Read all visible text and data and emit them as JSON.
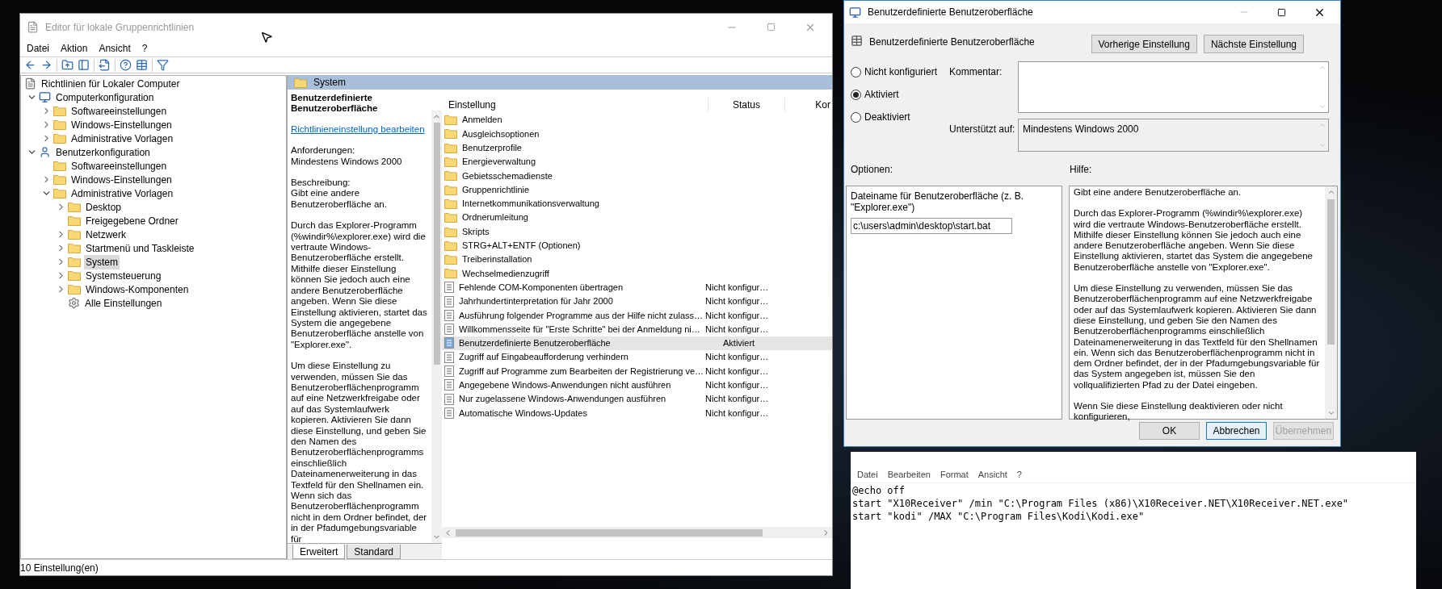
{
  "editor": {
    "title": "Editor für lokale Gruppenrichtlinien",
    "menu": [
      "Datei",
      "Aktion",
      "Ansicht",
      "?"
    ],
    "tree": {
      "label": "Richtlinien für Lokaler Computer",
      "kind": "policy",
      "selected": false,
      "children": [
        {
          "label": "Computerkonfiguration",
          "kind": "computer",
          "expanded": true,
          "selected": false,
          "children": [
            {
              "label": "Softwareeinstellungen",
              "expanded": false,
              "selected": false
            },
            {
              "label": "Windows-Einstellungen",
              "expanded": false,
              "selected": false
            },
            {
              "label": "Administrative Vorlagen",
              "expanded": false,
              "selected": false
            }
          ]
        },
        {
          "label": "Benutzerkonfiguration",
          "kind": "user",
          "expanded": true,
          "selected": false,
          "children": [
            {
              "label": "Softwareeinstellungen",
              "selected": false
            },
            {
              "label": "Windows-Einstellungen",
              "expanded": false,
              "selected": false
            },
            {
              "label": "Administrative Vorlagen",
              "expanded": true,
              "selected": false,
              "children": [
                {
                  "label": "Desktop",
                  "expanded": false,
                  "selected": false
                },
                {
                  "label": "Freigegebene Ordner",
                  "selected": false
                },
                {
                  "label": "Netzwerk",
                  "expanded": false,
                  "selected": false
                },
                {
                  "label": "Startmenü und Taskleiste",
                  "expanded": false,
                  "selected": false
                },
                {
                  "label": "System",
                  "expanded": false,
                  "selected": true
                },
                {
                  "label": "Systemsteuerung",
                  "expanded": false,
                  "selected": false
                },
                {
                  "label": "Windows-Komponenten",
                  "expanded": false,
                  "selected": false
                },
                {
                  "label": "Alle Einstellungen",
                  "kind": "all",
                  "selected": false
                }
              ]
            }
          ]
        }
      ]
    },
    "header": "System",
    "details": {
      "title": "Benutzerdefinierte Benutzeroberfläche",
      "link": "Richtlinieneinstellung bearbeiten",
      "requirements_label": "Anforderungen:",
      "requirements": "Mindestens Windows 2000",
      "description_label": "Beschreibung:",
      "paragraphs": [
        "Gibt eine andere Benutzeroberfläche an.",
        "Durch das Explorer-Programm (%windir%\\explorer.exe) wird die vertraute Windows-Benutzeroberfläche erstellt. Mithilfe dieser Einstellung können Sie jedoch auch eine andere Benutzeroberfläche angeben. Wenn Sie diese Einstellung aktivieren, startet das System die angegebene Benutzeroberfläche anstelle von \"Explorer.exe\".",
        "Um diese Einstellung zu verwenden, müssen Sie das Benutzeroberflächenprogramm auf eine Netzwerkfreigabe oder auf das Systemlaufwerk kopieren. Aktivieren Sie dann diese Einstellung, und geben Sie den Namen des Benutzeroberflächenprogramms einschließlich Dateinamenerweiterung in das Textfeld für den Shellnamen ein. Wenn sich das Benutzeroberflächenprogramm nicht in dem Ordner befindet, der in der Pfadumgebungsvariable für"
      ]
    },
    "columns": [
      "Einstellung",
      "Status",
      "Kor"
    ],
    "rows": [
      {
        "kind": "folder",
        "name": "Anmelden",
        "selected": false
      },
      {
        "kind": "folder",
        "name": "Ausgleichsoptionen",
        "selected": false
      },
      {
        "kind": "folder",
        "name": "Benutzerprofile",
        "selected": false
      },
      {
        "kind": "folder",
        "name": "Energieverwaltung",
        "selected": false
      },
      {
        "kind": "folder",
        "name": "Gebietsschemadienste",
        "selected": false
      },
      {
        "kind": "folder",
        "name": "Gruppenrichtlinie",
        "selected": false
      },
      {
        "kind": "folder",
        "name": "Internetkommunikationsverwaltung",
        "selected": false
      },
      {
        "kind": "folder",
        "name": "Ordnerumleitung",
        "selected": false
      },
      {
        "kind": "folder",
        "name": "Skripts",
        "selected": false
      },
      {
        "kind": "folder",
        "name": "STRG+ALT+ENTF (Optionen)",
        "selected": false
      },
      {
        "kind": "folder",
        "name": "Treiberinstallation",
        "selected": false
      },
      {
        "kind": "folder",
        "name": "Wechselmedienzugriff",
        "selected": false
      },
      {
        "kind": "setting",
        "name": "Fehlende COM-Komponenten übertragen",
        "status": "Nicht konfigur…",
        "selected": false
      },
      {
        "kind": "setting",
        "name": "Jahrhundertinterpretation für Jahr 2000",
        "status": "Nicht konfigur…",
        "selected": false
      },
      {
        "kind": "setting",
        "name": "Ausführung folgender Programme aus der Hilfe nicht zulass…",
        "status": "Nicht konfigur…",
        "selected": false
      },
      {
        "kind": "setting",
        "name": "Willkommensseite für \"Erste Schritte\" bei der Anmeldung ni…",
        "status": "Nicht konfigur…",
        "selected": false
      },
      {
        "kind": "setting",
        "name": "Benutzerdefinierte Benutzeroberfläche",
        "status": "Aktiviert",
        "selected": true
      },
      {
        "kind": "setting",
        "name": "Zugriff auf Eingabeaufforderung verhindern",
        "status": "Nicht konfigur…",
        "selected": false
      },
      {
        "kind": "setting",
        "name": "Zugriff auf Programme zum Bearbeiten der Registrierung ve…",
        "status": "Nicht konfigur…",
        "selected": false
      },
      {
        "kind": "setting",
        "name": "Angegebene Windows-Anwendungen nicht ausführen",
        "status": "Nicht konfigur…",
        "selected": false
      },
      {
        "kind": "setting",
        "name": "Nur zugelassene Windows-Anwendungen ausführen",
        "status": "Nicht konfigur…",
        "selected": false
      },
      {
        "kind": "setting",
        "name": "Automatische Windows-Updates",
        "status": "Nicht konfigur…",
        "selected": false
      }
    ],
    "tabs": [
      {
        "label": "Erweitert",
        "selected": true
      },
      {
        "label": "Standard",
        "selected": false
      }
    ],
    "status_bar": "10 Einstellung(en)"
  },
  "dialog": {
    "title": "Benutzerdefinierte Benutzeroberfläche",
    "heading": "Benutzerdefinierte Benutzeroberfläche",
    "nav_buttons": [
      "Vorherige Einstellung",
      "Nächste Einstellung"
    ],
    "radios": [
      {
        "label": "Nicht konfiguriert",
        "selected": false
      },
      {
        "label": "Aktiviert",
        "selected": true
      },
      {
        "label": "Deaktiviert",
        "selected": false
      }
    ],
    "comment_label": "Kommentar:",
    "supported_label": "Unterstützt auf:",
    "supported": "Mindestens Windows 2000",
    "options_label": "Optionen:",
    "help_label": "Hilfe:",
    "option": {
      "label": "Dateiname für Benutzeroberfläche (z. B. \"Explorer.exe\")",
      "value": "c:\\users\\admin\\desktop\\start.bat"
    },
    "help": [
      "Gibt eine andere Benutzeroberfläche an.",
      "Durch das Explorer-Programm (%windir%\\explorer.exe) wird die vertraute Windows-Benutzeroberfläche erstellt. Mithilfe dieser Einstellung können Sie jedoch auch eine andere Benutzeroberfläche angeben. Wenn Sie diese Einstellung aktivieren, startet das System die angegebene Benutzeroberfläche anstelle von \"Explorer.exe\".",
      "Um diese Einstellung zu verwenden, müssen Sie das Benutzeroberflächenprogramm auf eine Netzwerkfreigabe oder auf das Systemlaufwerk kopieren. Aktivieren Sie dann diese Einstellung, und geben Sie den Namen des Benutzeroberflächenprogramms einschließlich Dateinamenerweiterung in das Textfeld für den Shellnamen ein. Wenn sich das Benutzeroberflächenprogramm nicht in dem Ordner befindet, der in der Pfadumgebungsvariable für das System angegeben ist, müssen Sie den vollqualifizierten Pfad zu der Datei eingeben.",
      "Wenn Sie diese Einstellung deaktivieren oder nicht konfigurieren,"
    ],
    "buttons": [
      {
        "label": "OK",
        "focused": false,
        "disabled": false
      },
      {
        "label": "Abbrechen",
        "focused": true,
        "disabled": false
      },
      {
        "label": "Übernehmen",
        "focused": false,
        "disabled": true
      }
    ]
  },
  "notepad": {
    "menu": [
      "Datei",
      "Bearbeiten",
      "Format",
      "Ansicht",
      "?"
    ],
    "lines": [
      "@echo off",
      "start \"X10Receiver\" /min \"C:\\Program Files (x86)\\X10Receiver.NET\\X10Receiver.NET.exe\"",
      "start \"kodi\" /MAX \"C:\\Program Files\\Kodi\\Kodi.exe\""
    ]
  }
}
